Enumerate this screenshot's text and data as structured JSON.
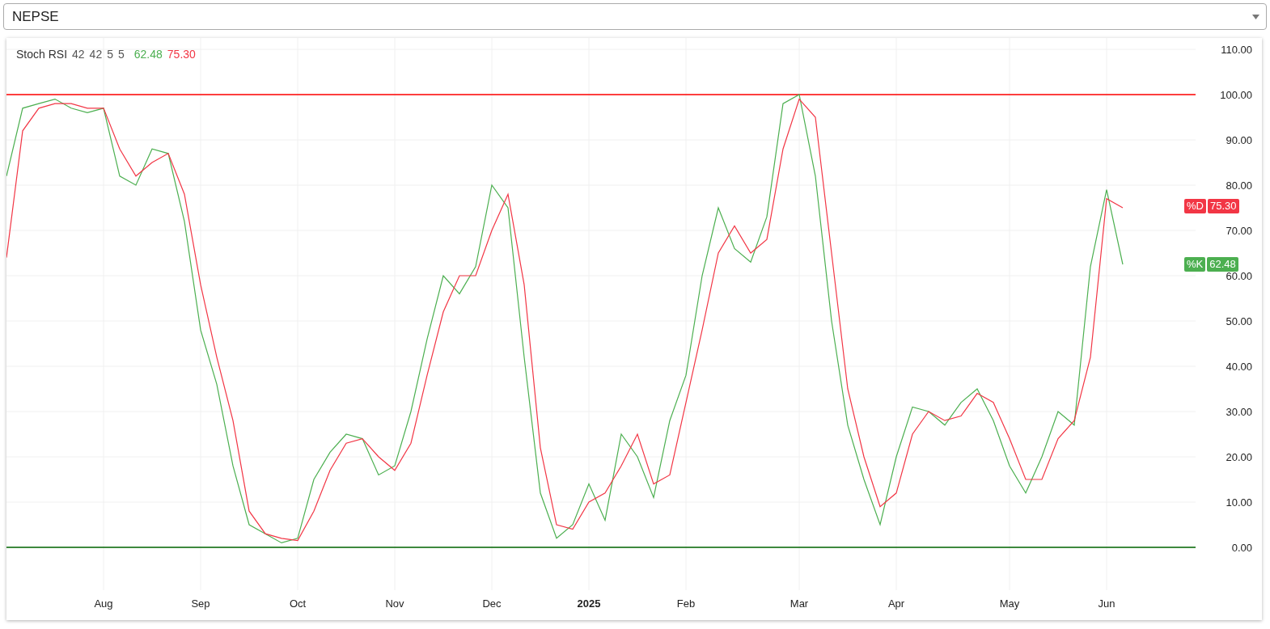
{
  "selector": {
    "value": "NEPSE"
  },
  "chart": {
    "legend": {
      "title": "Stoch RSI",
      "params": [
        "42",
        "42",
        "5",
        "5"
      ]
    },
    "price_labels": [
      {
        "value": "75.30"
      },
      {
        "value": "62.48"
      }
    ],
    "chart_data": {
      "type": "line",
      "categories": [
        null,
        null,
        null,
        null,
        null,
        null,
        "Aug",
        null,
        null,
        null,
        null,
        null,
        "Sep",
        null,
        null,
        null,
        null,
        null,
        "Oct",
        null,
        null,
        null,
        null,
        null,
        "Nov",
        null,
        null,
        null,
        null,
        null,
        "Dec",
        null,
        null,
        null,
        null,
        null,
        "**2025**",
        null,
        null,
        null,
        null,
        null,
        "Feb",
        null,
        null,
        null,
        null,
        null,
        null,
        "Mar",
        null,
        null,
        null,
        null,
        null,
        "Apr",
        null,
        null,
        null,
        null,
        null,
        null,
        "May",
        null,
        null,
        null,
        null,
        null,
        "Jun",
        null
      ],
      "series": [
        {
          "name": "%K",
          "color": "#4caf50",
          "values": [
            82,
            97,
            98,
            99,
            97,
            96,
            97,
            82,
            80,
            88,
            87,
            72,
            48,
            36,
            18,
            5,
            3,
            1,
            2,
            15,
            21,
            25,
            24,
            16,
            18,
            30,
            46,
            60,
            56,
            62,
            80,
            75,
            42,
            12,
            2,
            5,
            14,
            6,
            25,
            20,
            11,
            28,
            38,
            60,
            75,
            66,
            63,
            73,
            98,
            100,
            82,
            50,
            27,
            15,
            5,
            20,
            31,
            30,
            27,
            32,
            35,
            28,
            18,
            12,
            20,
            30,
            27,
            62,
            79,
            62.5
          ]
        },
        {
          "name": "%D",
          "color": "#f23645",
          "values": [
            64,
            92,
            97,
            98,
            98,
            97,
            97,
            88,
            82,
            85,
            87,
            78,
            58,
            42,
            28,
            8,
            3,
            2,
            1.5,
            8,
            17,
            23,
            24,
            20,
            17,
            23,
            38,
            52,
            60,
            60,
            70,
            78,
            58,
            22,
            5,
            4,
            10,
            12,
            18,
            25,
            14,
            16,
            32,
            48,
            65,
            71,
            65,
            68,
            88,
            99,
            95,
            65,
            35,
            20,
            9,
            12,
            25,
            30,
            28,
            29,
            34,
            32,
            24,
            15,
            15,
            24,
            28,
            42,
            77,
            75
          ]
        }
      ],
      "ylim": [
        -9.46,
        112.5
      ],
      "yticks": [
        {
          "value": 0,
          "label": "0.00"
        },
        {
          "value": 10,
          "label": "10.00"
        },
        {
          "value": 20,
          "label": "20.00"
        },
        {
          "value": 30,
          "label": "30.00"
        },
        {
          "value": 40,
          "label": "40.00"
        },
        {
          "value": 50,
          "label": "50.00"
        },
        {
          "value": 60,
          "label": "60.00"
        },
        {
          "value": 70,
          "label": "70.00"
        },
        {
          "value": 80,
          "label": "80.00"
        },
        {
          "value": 90,
          "label": "90.00"
        },
        {
          "value": 100,
          "label": "100.00"
        },
        {
          "value": 110,
          "label": "110.00"
        }
      ],
      "ref_lines": [
        {
          "axis": "y",
          "value": 100,
          "color": "#ff0000"
        },
        {
          "axis": "y",
          "value": 0,
          "color": "#006400"
        }
      ],
      "grid": true,
      "legend": true,
      "value_labels": [
        "62.48",
        "75.30"
      ]
    }
  }
}
